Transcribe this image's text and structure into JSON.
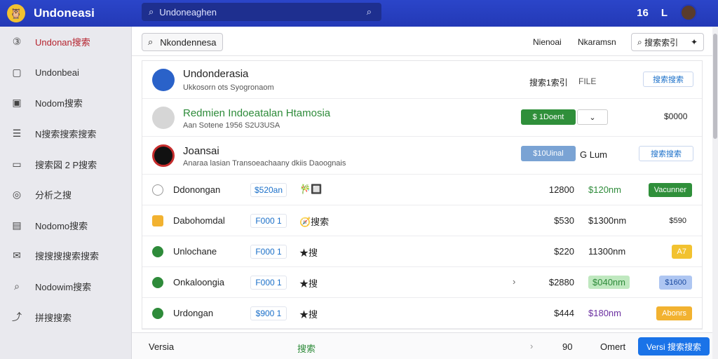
{
  "app": {
    "title": "Undoneasi",
    "logo_icon": "owl-logo-icon"
  },
  "search": {
    "value": "Undoneaghen",
    "placeholder": "Undoneaghen"
  },
  "topbar_right": {
    "badge_text": "16",
    "label_text": "L",
    "avatar_icon": "user-avatar-icon"
  },
  "sidebar": {
    "items": [
      {
        "icon": "circle-3-icon",
        "glyph": "③",
        "label": "Undonan搜索",
        "active": true
      },
      {
        "icon": "chat-bubble-icon",
        "glyph": "▢",
        "label": "Undonbeai"
      },
      {
        "icon": "news-icon",
        "glyph": "▣",
        "label": "Nodom搜索"
      },
      {
        "icon": "list-icon",
        "glyph": "☰",
        "label": "N搜索搜索搜索"
      },
      {
        "icon": "tag-icon",
        "glyph": "▭",
        "label": "搜索図 2 P搜索"
      },
      {
        "icon": "target-icon",
        "glyph": "◎",
        "label": "分析之搜"
      },
      {
        "icon": "calendar-icon",
        "glyph": "▤",
        "label": "Nodomo搜索"
      },
      {
        "icon": "message-icon",
        "glyph": "✉",
        "label": "搜搜搜搜索搜索"
      },
      {
        "icon": "search-icon",
        "glyph": "⌕",
        "label": "Nodowim搜索"
      },
      {
        "icon": "share-icon",
        "glyph": "⤴",
        "label": "拼搜搜索"
      }
    ]
  },
  "toolbar": {
    "filter_button": "Nkondennesa",
    "link1": "Nienoai",
    "link2": "Nkaramsn",
    "search_text": "搜索索引"
  },
  "rows_header": [
    {
      "title": "Undonderasia",
      "sub": "Ukkosorn ots Syogronaom",
      "col_a": "搜索1索引",
      "col_b": "FILE",
      "action": "搜索搜索"
    },
    {
      "title": "Redmien Indoeatalan Htamosia",
      "sub": "Aan Sotene 1956 S2U3USA",
      "button": "$ 1Doent",
      "price": "$0000"
    },
    {
      "title": "Joansai",
      "sub": "Anaraa lasian Transoeachaany dkiis Daoognais",
      "button": "$10Uinal",
      "label": "G Lum",
      "action": "搜索搜索"
    }
  ],
  "rows": [
    {
      "name": "Ddonongan",
      "code": "$520an",
      "icons": "🎋🔲",
      "num1": "12800",
      "num2": "$120nm",
      "badge": "Vacunner",
      "status": "empty",
      "badge_color": "#2f8f3a"
    },
    {
      "name": "Dabohomdal",
      "code": "F000 1",
      "icons": "🧭搜索",
      "num1": "$530",
      "num2": "$1300nm",
      "badge": "$590",
      "status": "warning",
      "badge_color": "transparent"
    },
    {
      "name": "Unlochane",
      "code": "F000 1",
      "icons": "★搜",
      "num1": "$220",
      "num2": "11300nm",
      "badge": "A7",
      "status": "ok",
      "badge_color": "#f2c230"
    },
    {
      "name": "Onkaloongia",
      "code": "F000 1",
      "icons": "★搜",
      "num1": "$2880",
      "num2": "$040nm",
      "badge": "$1600",
      "status": "ok",
      "badge_color": "#aec6f2"
    },
    {
      "name": "Urdongan",
      "code": "$900 1",
      "icons": "★搜",
      "num1": "$444",
      "num2": "$180nm",
      "badge": "Abonrs",
      "status": "ok",
      "badge_color": "#f2b230"
    }
  ],
  "footer": {
    "label": "Versia",
    "mid": "搜索",
    "num": "90",
    "text": "Omert",
    "button": "Versi  搜索搜索"
  },
  "colors": {
    "topbar": "#2339b6",
    "accent_red": "#b5232e",
    "accent_green": "#2f8f3a",
    "button_blue": "#1a73e8"
  }
}
